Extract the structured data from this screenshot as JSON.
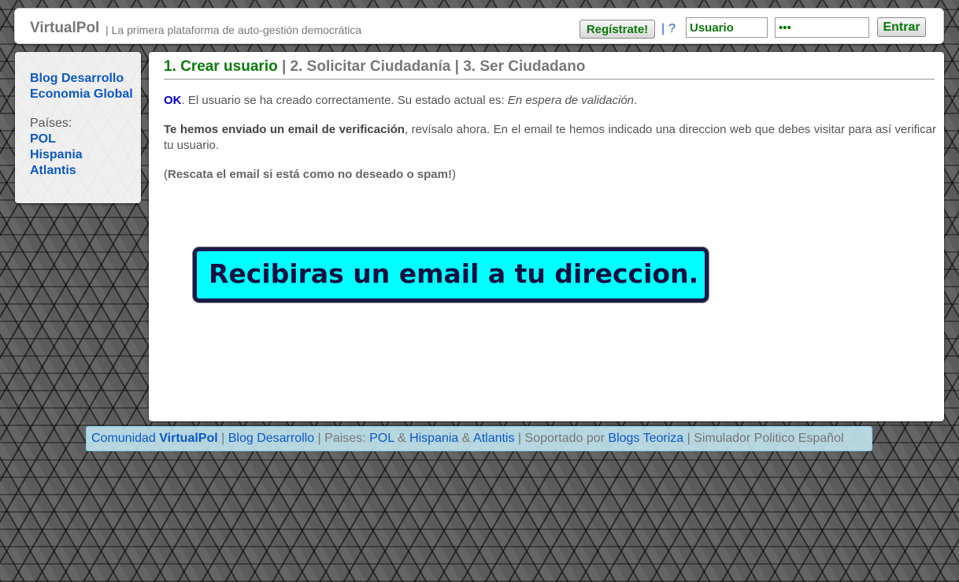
{
  "header": {
    "brand": "VirtualPol",
    "separator": "|",
    "tagline": "La primera plataforma de auto-gestión democrática",
    "register_label": "Regístrate!",
    "pipe": "|",
    "help_label": "?",
    "username_value": "Usuario",
    "password_value": "•••",
    "enter_label": "Entrar"
  },
  "sidebar": {
    "blog_label": "Blog Desarrollo",
    "economy_label": "Economia Global",
    "countries_label": "Países:",
    "countries": [
      "POL",
      "Hispania",
      "Atlantis"
    ]
  },
  "main": {
    "steps": {
      "step1": "1. Crear usuario",
      "sep1": " | ",
      "step2": "2. Solicitar Ciudadanía",
      "sep2": " | ",
      "step3": "3. Ser Ciudadano"
    },
    "status": {
      "ok": "OK",
      "text": ". El usuario se ha creado correctamente. Su estado actual es: ",
      "state": "En espera de validación",
      "end": "."
    },
    "email_notice": {
      "bold": "Te hemos enviado un email de verificación",
      "text": ", revísalo ahora. En el email te hemos indicado una direccion web que debes visitar para así verificar tu usuario."
    },
    "spam_notice": {
      "open": "(",
      "bold": "Rescata el email si está como no deseado o spam!",
      "close": ")"
    }
  },
  "banner": {
    "text": "Recibiras un email a tu direccion."
  },
  "footer": {
    "community_prefix": "Comunidad ",
    "community_name": "VirtualPol",
    "sep1": " | ",
    "blog_label": "Blog Desarrollo",
    "sep2": " | ",
    "countries_prefix": "Paises: ",
    "country1": "POL",
    "amp1": " & ",
    "country2": "Hispania",
    "amp2": " & ",
    "country3": "Atlantis",
    "sep3": " | ",
    "supported_prefix": "Soportado por ",
    "blogs_label": "Blogs Teoriza",
    "sep4": " | ",
    "simulator_label": "Simulador Politico Español"
  },
  "colors": {
    "accent_green": "#0a7a0a",
    "link_blue": "#0c58c8",
    "banner_cyan": "#00ffff",
    "banner_border": "#1a1a4a"
  }
}
